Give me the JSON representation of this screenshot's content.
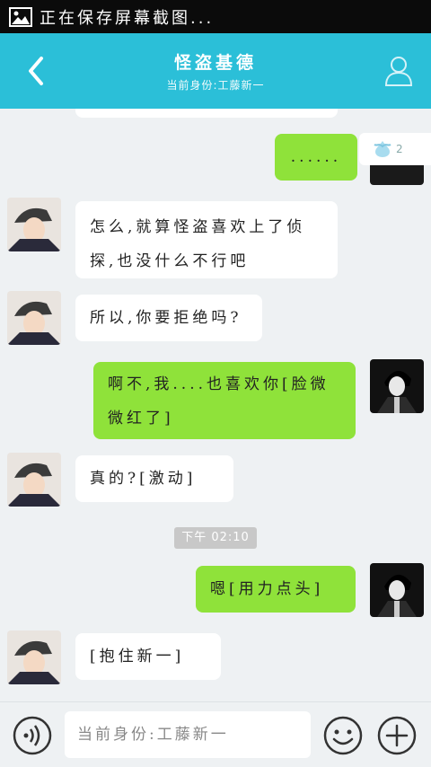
{
  "status_bar": {
    "text": "正在保存屏幕截图...",
    "icon": "image-icon"
  },
  "header": {
    "title": "怪盗基德",
    "subtitle": "当前身份:工藤新一",
    "back_icon": "chevron-left-icon",
    "profile_icon": "user-icon",
    "color": "#2bbfd8"
  },
  "tag_badge": {
    "count": "2"
  },
  "messages": [
    {
      "side": "right",
      "text": "......"
    },
    {
      "side": "left",
      "text": "怎么,就算怪盗喜欢上了侦探,也没什么不行吧"
    },
    {
      "side": "left",
      "text": "所以,你要拒绝吗?"
    },
    {
      "side": "right",
      "text": "啊不,我....也喜欢你[脸微微红了]"
    },
    {
      "side": "left",
      "text": "真的?[激动]"
    },
    {
      "side": "right",
      "text": "嗯[用力点头]"
    },
    {
      "side": "left",
      "text": "[抱住新一]"
    }
  ],
  "timestamp": "下午 02:10",
  "input_bar": {
    "placeholder": "当前身份:工藤新一",
    "voice_icon": "voice-icon",
    "emoji_icon": "smiley-icon",
    "plus_icon": "plus-icon"
  },
  "colors": {
    "left_bubble": "#ffffff",
    "right_bubble": "#8fe23a",
    "background": "#eef1f3"
  }
}
